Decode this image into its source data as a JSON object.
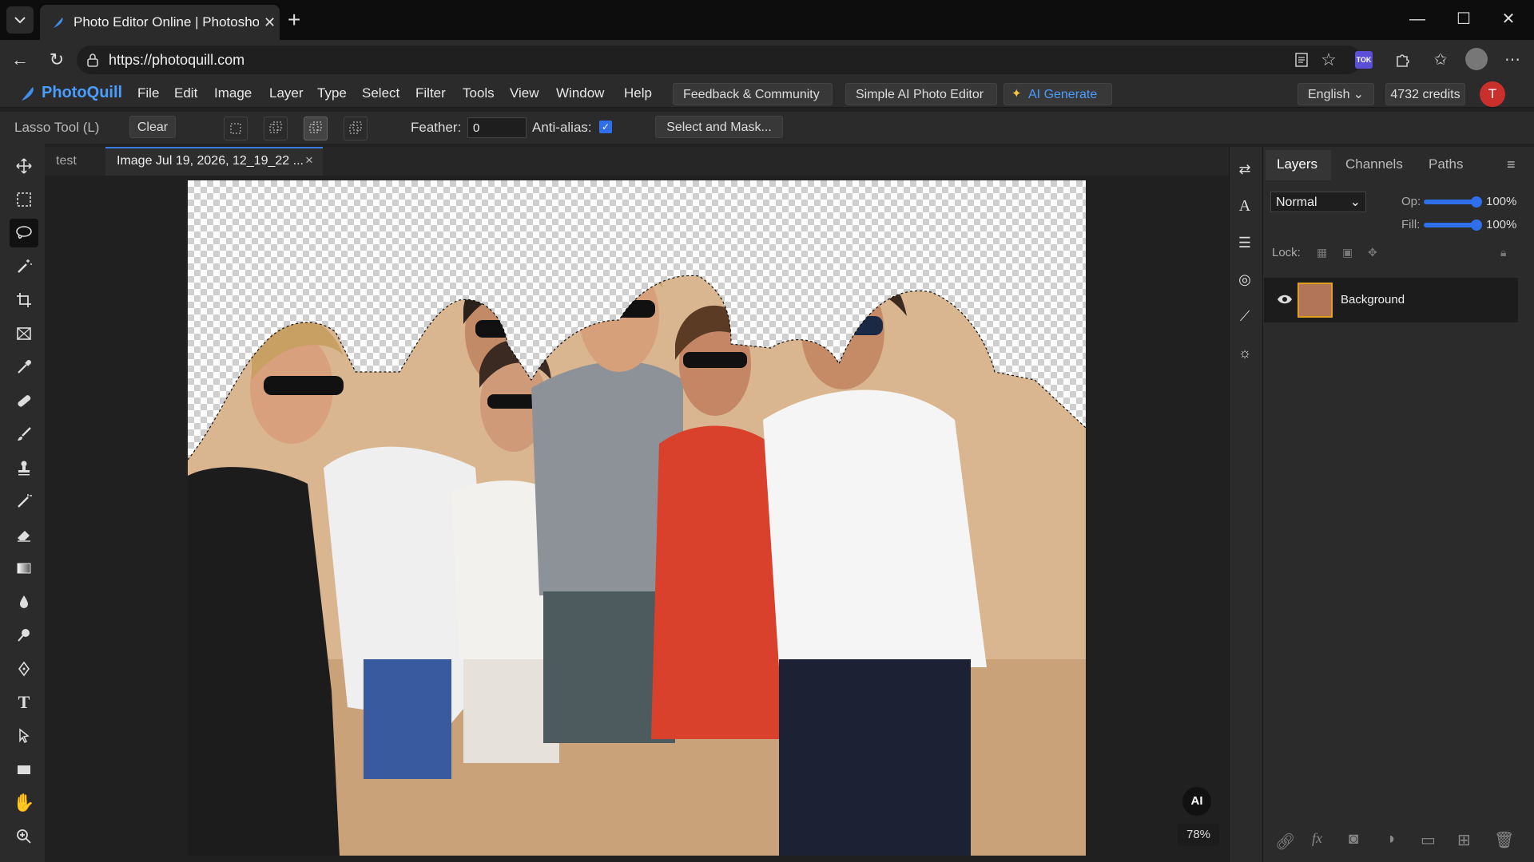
{
  "browser": {
    "tab_title": "Photo Editor Online | Photoshop A",
    "url": "https://photoquill.com"
  },
  "menubar": {
    "brand": "PhotoQuill",
    "items": [
      "File",
      "Edit",
      "Image",
      "Layer",
      "Type",
      "Select",
      "Filter",
      "Tools",
      "View",
      "Window",
      "Help"
    ],
    "feedback": "Feedback & Community",
    "simple_ai": "Simple AI Photo Editor",
    "ai_generate": "AI Generate",
    "language": "English",
    "credits": "4732 credits",
    "avatar": "T"
  },
  "options": {
    "tool_name": "Lasso Tool (L)",
    "clear": "Clear",
    "feather_label": "Feather:",
    "feather_value": "0",
    "antialias_label": "Anti-alias:",
    "select_mask": "Select and Mask..."
  },
  "doc_tabs": {
    "tab1": "test",
    "tab2": "Image Jul 19, 2026, 12_19_22 ...",
    "close": "×"
  },
  "canvas": {
    "ai_badge": "AI",
    "zoom": "78%"
  },
  "layers_panel": {
    "tabs": [
      "Layers",
      "Channels",
      "Paths"
    ],
    "blend_mode": "Normal",
    "opacity_label": "Op:",
    "opacity_value": "100%",
    "opacity_level": 1.0,
    "fill_label": "Fill:",
    "fill_value": "100%",
    "fill_level": 1.0,
    "lock_label": "Lock:",
    "layer_name": "Background"
  },
  "colors": {
    "accent": "#2f6fea",
    "brand": "#4a9cff",
    "avatar_bg": "#c9302c"
  }
}
